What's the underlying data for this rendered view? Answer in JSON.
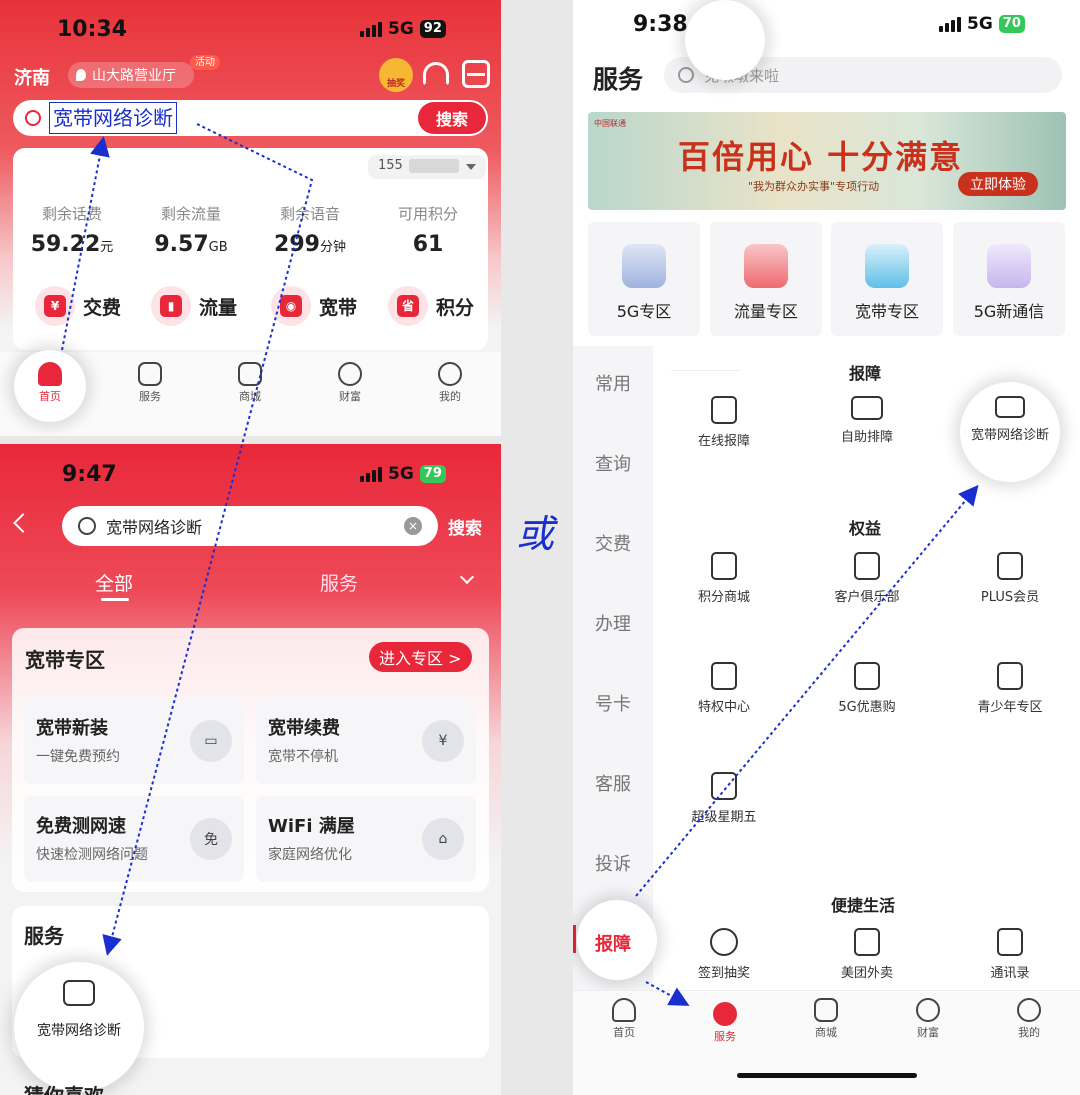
{
  "p1": {
    "time": "10:34",
    "network": "5G",
    "battery": "92",
    "city": "济南",
    "store": "山大路营业厅",
    "activity_badge": "活动",
    "lottery_badge": "抽奖",
    "search_text": "宽带网络诊断",
    "search_btn": "搜索",
    "phone": "155",
    "stats": [
      {
        "label": "剩余话费",
        "value": "59.22",
        "unit": "元"
      },
      {
        "label": "剩余流量",
        "value": "9.57",
        "unit": "GB"
      },
      {
        "label": "剩余语音",
        "value": "299",
        "unit": "分钟"
      },
      {
        "label": "可用积分",
        "value": "61",
        "unit": ""
      }
    ],
    "quick": [
      {
        "label": "交费",
        "glyph": "¥"
      },
      {
        "label": "流量",
        "glyph": "▮"
      },
      {
        "label": "宽带",
        "glyph": "◉"
      },
      {
        "label": "积分",
        "glyph": "省"
      }
    ],
    "tabs": [
      "首页",
      "服务",
      "商城",
      "财富",
      "我的"
    ]
  },
  "p2": {
    "time": "9:47",
    "network": "5G",
    "battery": "79",
    "search_text": "宽带网络诊断",
    "search_btn": "搜索",
    "tab_all": "全部",
    "tab_service": "服务",
    "zone_title": "宽带专区",
    "zone_enter": "进入专区 >",
    "tiles": [
      {
        "title": "宽带新装",
        "sub": "一键免费预约",
        "glyph": "▭"
      },
      {
        "title": "宽带续费",
        "sub": "宽带不停机",
        "glyph": "¥"
      },
      {
        "title": "免费测网速",
        "sub": "快速检测网络问题",
        "glyph": "免"
      },
      {
        "title": "WiFi 满屋",
        "sub": "家庭网络优化",
        "glyph": "⌂"
      }
    ],
    "service_title": "服务",
    "service_item": "宽带网络诊断",
    "bottom_text": "猜你喜欢"
  },
  "or_label": "或",
  "p3": {
    "time": "9:38",
    "network": "5G",
    "battery": "70",
    "title": "服务",
    "search_placeholder": "免墩墩来啦",
    "banner_logo": "中国联通",
    "banner_title": "百倍用心 十分满意",
    "banner_sub": "\"我为群众办实事\"专项行动",
    "banner_btn": "立即体验",
    "zones": [
      "5G专区",
      "流量专区",
      "宽带专区",
      "5G新通信"
    ],
    "categories": [
      "常用",
      "查询",
      "交费",
      "办理",
      "号卡",
      "客服",
      "投诉",
      "报障"
    ],
    "sections": [
      {
        "title": "报障",
        "items": [
          "在线报障",
          "自助排障",
          "宽带网络诊断"
        ]
      },
      {
        "title": "权益",
        "items": [
          "积分商城",
          "客户俱乐部",
          "PLUS会员",
          "特权中心",
          "5G优惠购",
          "青少年专区",
          "超级星期五"
        ]
      },
      {
        "title": "便捷生活",
        "items": [
          "签到抽奖",
          "美团外卖",
          "通讯录"
        ]
      }
    ],
    "tabs": [
      "首页",
      "服务",
      "商城",
      "财富",
      "我的"
    ]
  },
  "colors": {
    "brand_red": "#e8283a",
    "arrow_blue": "#1a2fd0"
  }
}
